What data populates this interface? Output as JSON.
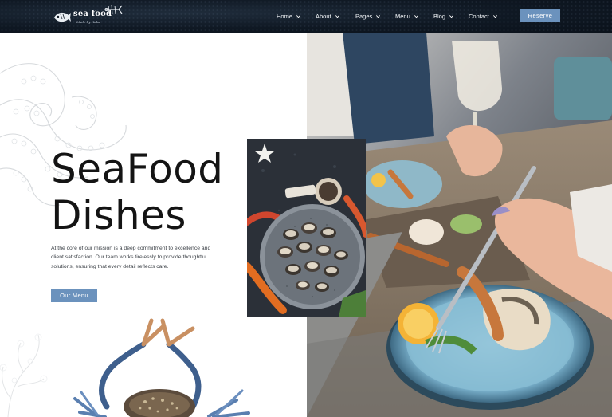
{
  "brand": {
    "name": "sea food",
    "tagline": "Made by Heba"
  },
  "nav": {
    "items": [
      {
        "label": "Home"
      },
      {
        "label": "About"
      },
      {
        "label": "Pages"
      },
      {
        "label": "Menu"
      },
      {
        "label": "Blog"
      },
      {
        "label": "Contact"
      }
    ],
    "cta": "Reserve"
  },
  "hero": {
    "title_line1": "SeaFood",
    "title_line2": "Dishes",
    "description": "At the core of our mission is a deep commitment to excellence and client satisfaction. Our team works tirelessly to provide thoughtful solutions, ensuring that every detail reflects care.",
    "button": "Our Menu"
  },
  "colors": {
    "accent": "#6b92bd",
    "nav_bg": "#0f1823",
    "title": "#141414",
    "plate": "#7fb3cf"
  },
  "icons": [
    "fish-logo-icon",
    "chevron-down-icon",
    "starfish-icon"
  ]
}
